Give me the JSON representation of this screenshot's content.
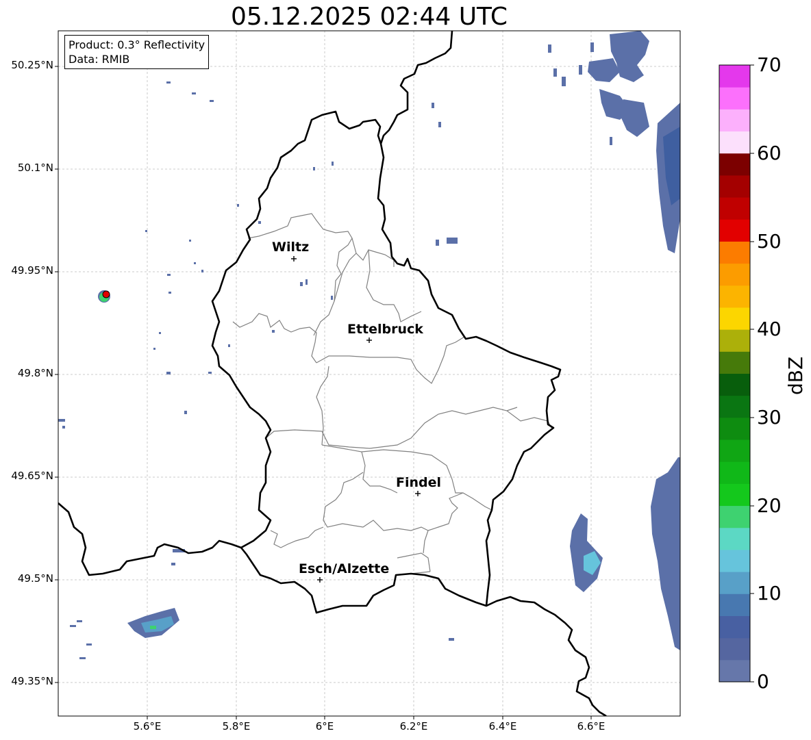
{
  "title": "05.12.2025 02:44 UTC",
  "info": {
    "product": "Product: 0.3° Reflectivity",
    "data": "Data: RMIB"
  },
  "axes": {
    "lat_labels": [
      "50.25°N",
      "50.1°N",
      "49.95°N",
      "49.8°N",
      "49.65°N",
      "49.5°N",
      "49.35°N"
    ],
    "lon_labels": [
      "5.6°E",
      "5.8°E",
      "6°E",
      "6.2°E",
      "6.4°E",
      "6.6°E"
    ]
  },
  "cities": [
    {
      "name": "Wiltz"
    },
    {
      "name": "Ettelbruck"
    },
    {
      "name": "Findel"
    },
    {
      "name": "Esch/Alzette"
    }
  ],
  "colorbar": {
    "unit": "dBZ",
    "tick_labels": [
      "0",
      "10",
      "20",
      "30",
      "40",
      "50",
      "60",
      "70"
    ],
    "colors": [
      "#6677aa",
      "#5566a0",
      "#4860a2",
      "#4878b0",
      "#58a0c8",
      "#66c4dc",
      "#5cd8c4",
      "#3ed270",
      "#14c81c",
      "#10b818",
      "#10a614",
      "#0e8c10",
      "#0a7612",
      "#085e0c",
      "#467a0a",
      "#acb00a",
      "#fcd600",
      "#fcb400",
      "#fc9c00",
      "#fc7c00",
      "#e20000",
      "#c00000",
      "#a40000",
      "#7c0000",
      "#fce0fc",
      "#fcb0fc",
      "#fc70fc",
      "#e438ec"
    ]
  }
}
